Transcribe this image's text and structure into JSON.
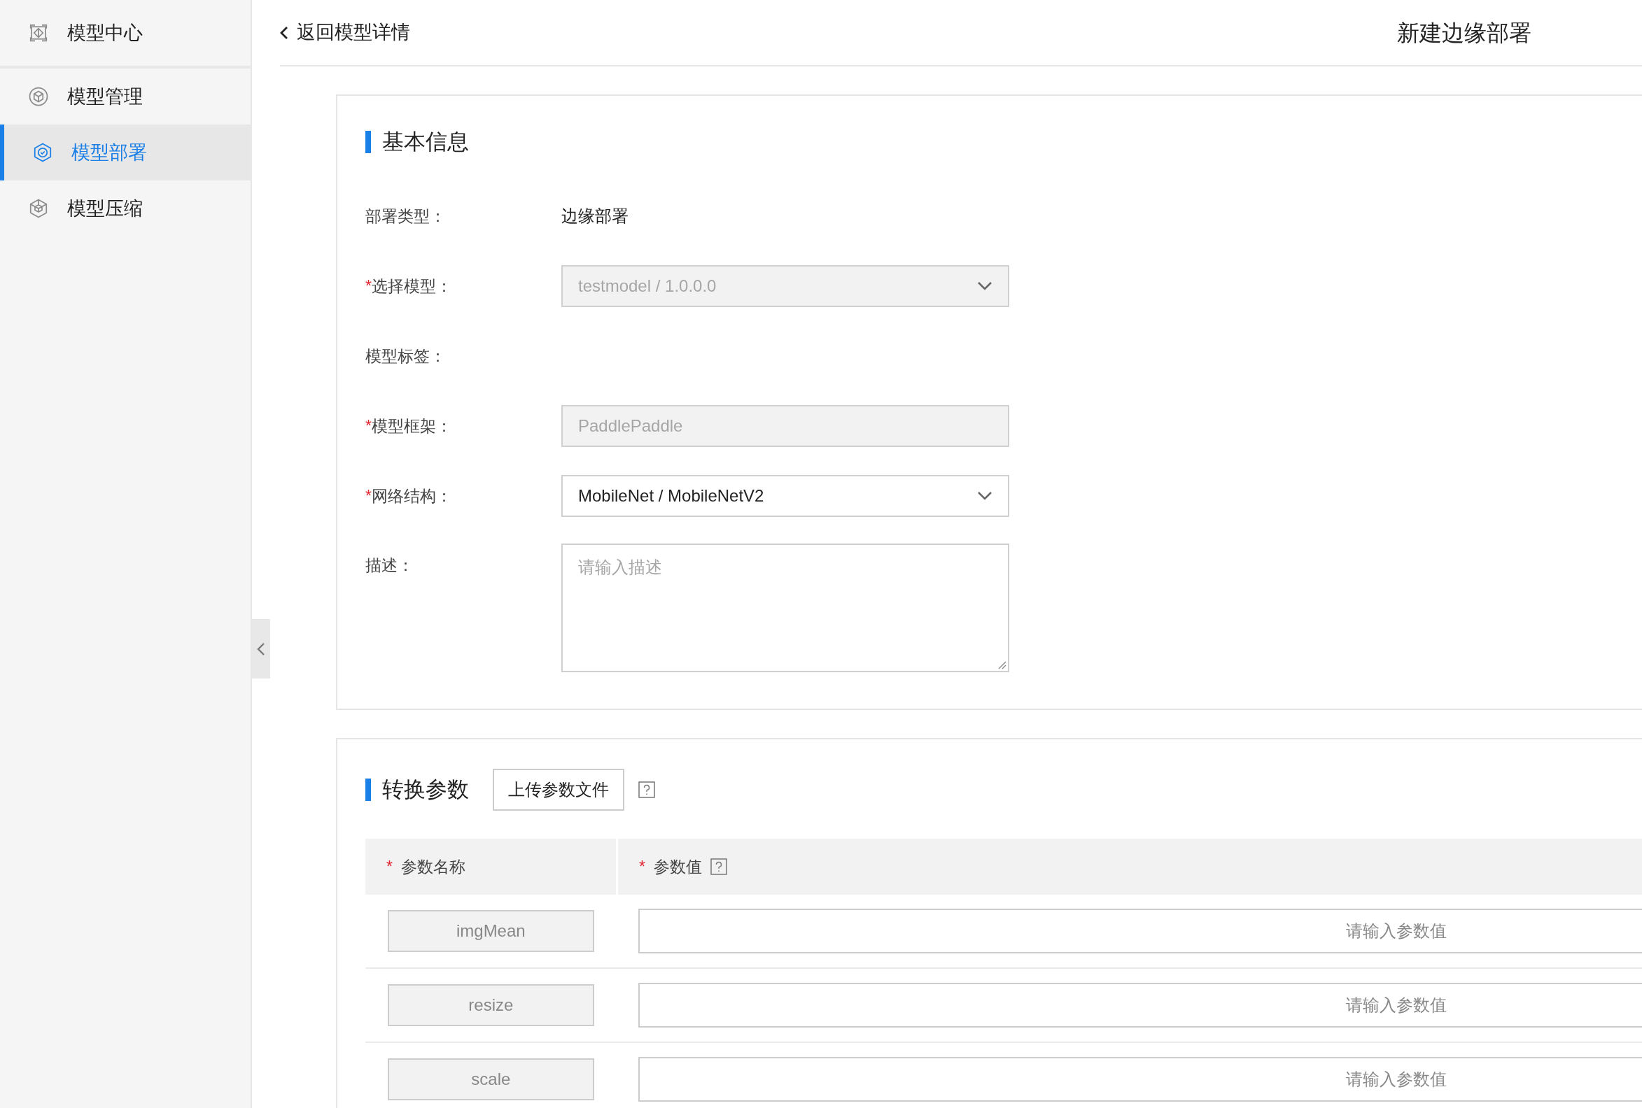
{
  "sidebar": {
    "items": [
      {
        "label": "模型中心",
        "selected": false
      },
      {
        "label": "模型管理",
        "selected": false
      },
      {
        "label": "模型部署",
        "selected": true
      },
      {
        "label": "模型压缩",
        "selected": false
      }
    ]
  },
  "header": {
    "back_link": "返回模型详情",
    "title": "新建边缘部署"
  },
  "basic_info": {
    "title": "基本信息",
    "fields": [
      {
        "kind": "text",
        "label": "部署类型：",
        "value": "边缘部署"
      },
      {
        "kind": "select",
        "mark": "*",
        "label": "选择模型：",
        "value": "testmodel / 1.0.0.0",
        "disabled": true
      },
      {
        "kind": "text",
        "label": "模型标签："
      },
      {
        "kind": "input",
        "mark": "*",
        "label": "模型框架：",
        "value": "PaddlePaddle",
        "disabled": true
      },
      {
        "kind": "select",
        "mark": "*",
        "label": "网络结构：",
        "value": "MobileNet / MobileNetV2",
        "disabled": false
      },
      {
        "kind": "textarea",
        "label": "描述：",
        "placeholder": "请输入描述"
      }
    ]
  },
  "params": {
    "title": "转换参数",
    "upload_button": "上传参数文件",
    "columns": [
      {
        "mark": "*",
        "label": "参数名称",
        "help": false
      },
      {
        "mark": "*",
        "label": "参数值",
        "help": true
      }
    ],
    "rows": [
      {
        "name": "imgMean",
        "placeholder": "请输入参数值"
      },
      {
        "name": "resize",
        "placeholder": "请输入参数值"
      },
      {
        "name": "scale",
        "placeholder": "请输入参数值"
      }
    ]
  }
}
